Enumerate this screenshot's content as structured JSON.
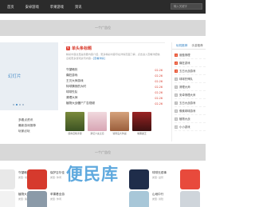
{
  "nav": {
    "items": [
      "首页",
      "安卓游戏",
      "苹果游戏",
      "资讯"
    ],
    "search_placeholder": "输入关键字"
  },
  "ads": {
    "top": "一个广告位",
    "mid": "一个广告位"
  },
  "slider": {
    "text": "幻灯片",
    "dot_count": 4,
    "active_index": 1
  },
  "left_links": [
    "多看点资讯",
    "最新游戏推荐",
    "玩家必玩"
  ],
  "headline": {
    "badge": "头",
    "title": "单头条标题",
    "summary": "精彩内容这里是简要内容介绍，更多精彩内容尽在详情页面了解，点击进入查看详细信息和更多游戏资讯内容...",
    "more": "[查看详情]"
  },
  "news": [
    {
      "title": "守望暗处",
      "date": "02-26"
    },
    {
      "title": "痛狂游戏",
      "date": "02-26"
    },
    {
      "title": "王贝大师游戏",
      "date": "02-26"
    },
    {
      "title": "特球猜测的大时",
      "date": "02-26"
    },
    {
      "title": "球球先队",
      "date": "02-26"
    },
    {
      "title": "清理大师",
      "date": "02-26"
    },
    {
      "title": "植物大战僵尸广告视频",
      "date": "02-26"
    }
  ],
  "thumbs": [
    {
      "caption": "使命召唤手游"
    },
    {
      "caption": "梦幻少女之恋"
    },
    {
      "caption": "冒险岛大作战"
    },
    {
      "caption": "暗黑魔王"
    }
  ],
  "side": {
    "tabs": [
      "玩机推荐",
      "手游推荐"
    ],
    "items": [
      {
        "n": "1",
        "title": "谁做清理"
      },
      {
        "n": "2",
        "title": "痛狂游戏"
      },
      {
        "n": "3",
        "title": "五日大战游戏"
      },
      {
        "n": "4",
        "title": "球球先锋队"
      },
      {
        "n": "5",
        "title": "清理大师"
      },
      {
        "n": "6",
        "title": "安卓清理大师"
      },
      {
        "n": "7",
        "title": "五日大战游戏"
      },
      {
        "n": "8",
        "title": "像素球球游戏"
      },
      {
        "n": "9",
        "title": "植物大战"
      },
      {
        "n": "10",
        "title": "小小游戏"
      }
    ]
  },
  "cards": [
    {
      "name": "守望暗处",
      "meta": "类型: 动作"
    },
    {
      "name": "保护吉尔佳",
      "meta": "类型: 休闲"
    },
    {
      "name": "球球无烦事",
      "meta": "类型: 益智"
    },
    {
      "name": "植物大战僵尸广...",
      "meta": "类型: 策略"
    },
    {
      "name": "苹果看全游",
      "meta": "类型: 休闲"
    },
    {
      "name": "山地中行",
      "meta": "类型: 冒险"
    }
  ],
  "watermark": "便民库",
  "colors": {
    "topbar": "#2b2b2b",
    "accent_red": "#d83a2c",
    "accent_blue": "#2f7fc1"
  }
}
